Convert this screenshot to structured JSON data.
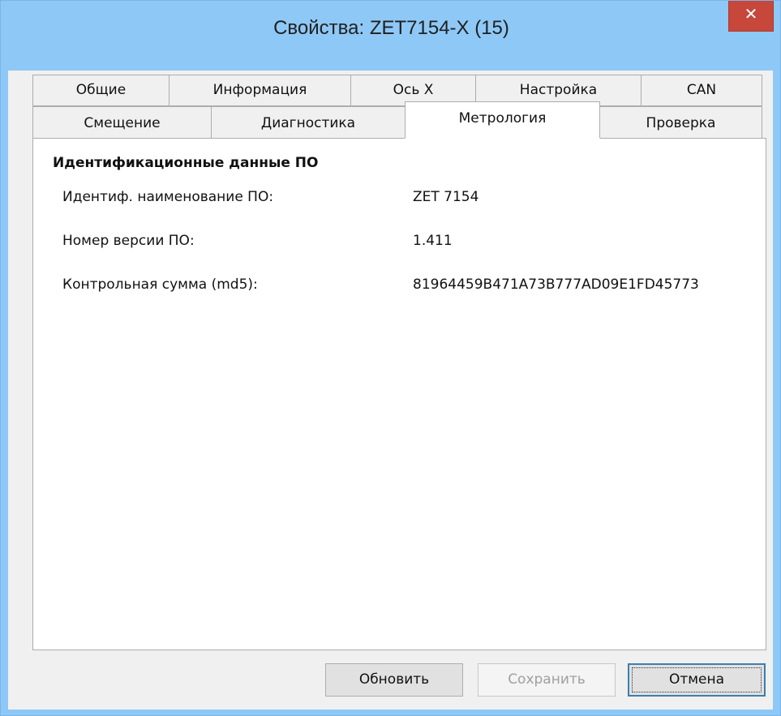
{
  "window": {
    "title": "Свойства: ZET7154-X (15)",
    "close_glyph": "✕"
  },
  "tabs": {
    "row1": [
      {
        "label": "Общие"
      },
      {
        "label": "Информация"
      },
      {
        "label": "Ось X"
      },
      {
        "label": "Настройка"
      },
      {
        "label": "CAN"
      }
    ],
    "row2": [
      {
        "label": "Смещение"
      },
      {
        "label": "Диагностика"
      },
      {
        "label": "Метрология",
        "active": true
      },
      {
        "label": "Проверка"
      }
    ]
  },
  "panel": {
    "section_title": "Идентификационные данные ПО",
    "rows": [
      {
        "label": "Идентиф. наименование ПО:",
        "value": "ZET 7154"
      },
      {
        "label": "Номер версии ПО:",
        "value": "1.411"
      },
      {
        "label": "Контрольная сумма (md5):",
        "value": "81964459B471A73B777AD09E1FD45773"
      }
    ]
  },
  "buttons": {
    "refresh": "Обновить",
    "save": "Сохранить",
    "cancel": "Отмена"
  },
  "colors": {
    "frame": "#8ec8f6",
    "close": "#c7473a",
    "dialog_bg": "#f0f0f0"
  }
}
